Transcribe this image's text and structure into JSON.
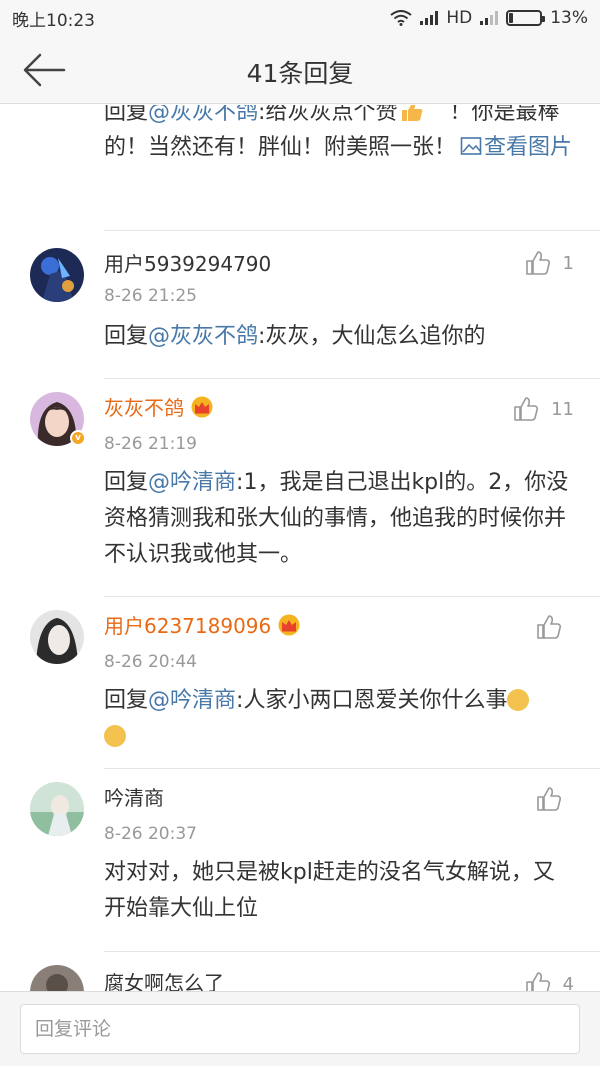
{
  "status_bar": {
    "time": "晚上10:23",
    "network": "HD",
    "battery": "13%",
    "battery_level": 0.13
  },
  "header": {
    "title": "41条回复"
  },
  "top_partial": {
    "prefix": "回复",
    "mention": "@灰灰不鸽",
    "text_before_emoji": ":给灰灰点个赞",
    "text_after_emoji": "！你是最棒的！当然还有！胖仙！附美照一张！",
    "image_link": "查看图片"
  },
  "comments": [
    {
      "name": "用户5939294790",
      "time": "8-26 21:25",
      "likes": "1",
      "prefix": "回复",
      "mention": "@灰灰不鸽",
      "text": ":灰灰，大仙怎么追你的"
    },
    {
      "name": "灰灰不鸽",
      "time": "8-26 21:19",
      "likes": "11",
      "prefix": "回复",
      "mention": "@吟清商",
      "text": ":1，我是自己退出kpl的。2，你没资格猜测我和张大仙的事情，他追我的时候你并不认识我或他其一。"
    },
    {
      "name": "用户6237189096",
      "time": "8-26 20:44",
      "likes": "",
      "prefix": "回复",
      "mention": "@吟清商",
      "text": ":人家小两口恩爱关你什么事"
    },
    {
      "name": "吟清商",
      "time": "8-26 20:37",
      "likes": "",
      "text": "对对对，她只是被kpl赶走的没名气女解说，又开始靠大仙上位"
    },
    {
      "name": "腐女啊怎么了",
      "likes": "4"
    }
  ],
  "footer": {
    "reply_placeholder": "回复评论"
  },
  "colors": {
    "link": "#4878a8",
    "vip_name": "#e86a14",
    "muted": "#999999"
  },
  "icons": [
    "back-arrow-icon",
    "wifi-icon",
    "signal-icon",
    "battery-icon",
    "thumbs-up-icon",
    "crown-icon",
    "verified-badge-icon",
    "image-icon",
    "doge-emoji-icon",
    "thumbs-up-emoji-icon"
  ]
}
